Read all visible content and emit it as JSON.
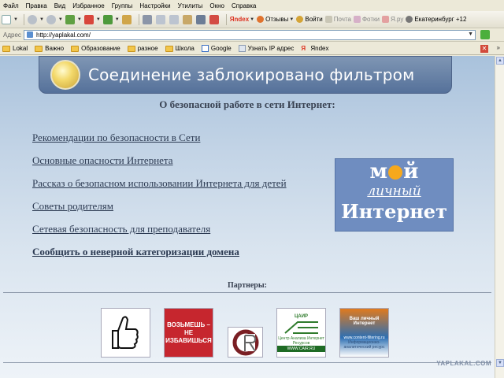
{
  "menu": [
    "Файл",
    "Правка",
    "Вид",
    "Избранное",
    "Группы",
    "Настройки",
    "Утилиты",
    "Окно",
    "Справка"
  ],
  "toolbar": {
    "yandex_label": "Яndex",
    "reviews": "Отзывы",
    "login": "Войти",
    "mail": "Почта",
    "photos": "Фотки",
    "yaru": "Я.ру",
    "weather": "Екатеринбург +12"
  },
  "address": {
    "label": "Адрес",
    "url": "http://yaplakal.com/"
  },
  "links_bar": [
    "Lokal",
    "Важно",
    "Образование",
    "разное",
    "Школа",
    "Google",
    "Узнать IP адрес",
    "Яndex"
  ],
  "page": {
    "banner_title": "Соединение заблокировано фильтром",
    "subtitle": "О безопасной работе в сети Интернет:",
    "links": [
      "Рекомендации по безопасности в Сети",
      "Основные опасности Интернета",
      "Рассказ о безопасном использовании Интернета для детей",
      "Советы родителям",
      "Сетевая безопасность для преподавателя"
    ],
    "report_link": "Сообщить о неверной категоризации домена",
    "logo": {
      "l1a": "м",
      "l1b": "й",
      "l2": "личный",
      "l3": "Интернет"
    },
    "partners_label": "Партнеры:",
    "partner2_text": "ВОЗЬМЕШЬ – НЕ ИЗБАВИШЬСЯ",
    "partner4": {
      "tag": "ЦАИР",
      "line1": "Центр Анализа Интернет Ресурсов",
      "line2": "WWW.CAIR.RU"
    },
    "partner5": {
      "line1": "Ваш личный Интернет",
      "line2": "www.content-filtering.ru",
      "line3": "Информационно-аналитический ресурс"
    },
    "watermark": "YAPLAKAL.COM"
  }
}
